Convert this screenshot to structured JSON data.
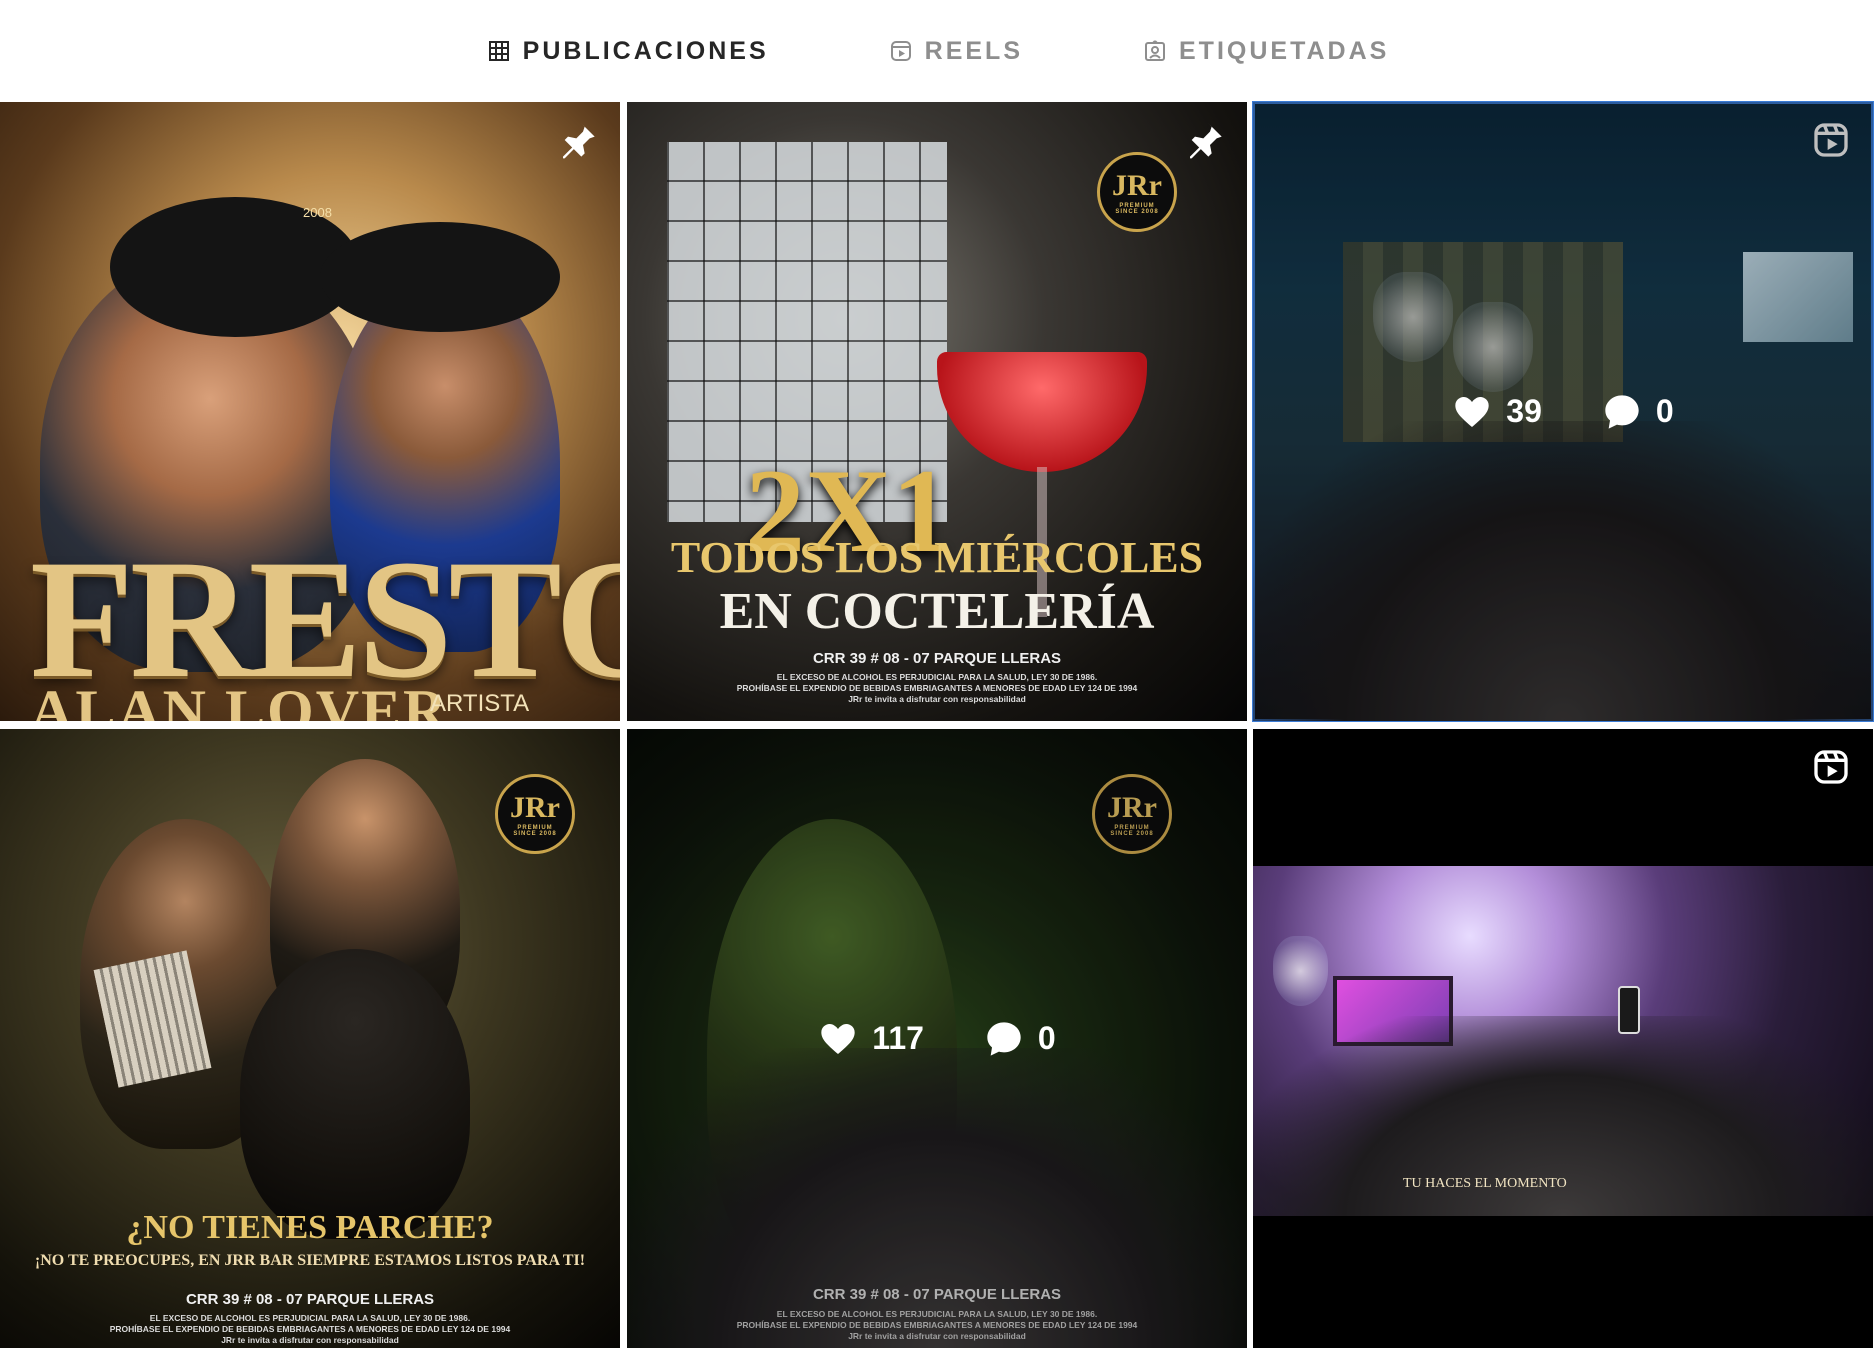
{
  "tabs": [
    {
      "label": "PUBLICACIONES",
      "icon": "grid-icon",
      "active": true
    },
    {
      "label": "REELS",
      "icon": "reels-icon",
      "active": false
    },
    {
      "label": "ETIQUETADAS",
      "icon": "tagged-icon",
      "active": false
    }
  ],
  "posts": {
    "p1": {
      "title": "FRESTO",
      "subtitle": "ALAN LOVER",
      "role": "ARTISTA",
      "year": "2008",
      "pinned": true
    },
    "p2": {
      "promo": "2X1",
      "line1": "TODOS LOS MIÉRCOLES",
      "line2": "EN COCTELERÍA",
      "address": "CRR 39 # 08 - 07  PARQUE LLERAS",
      "legal1": "EL EXCESO DE ALCOHOL ES PERJUDICIAL PARA LA SALUD, LEY 30 DE 1986.",
      "legal2": "PROHÍBASE EL EXPENDIO DE BEBIDAS EMBRIAGANTES A MENORES DE EDAD LEY 124 DE 1994",
      "legal3": "JRr te invita a disfrutar con responsabilidad",
      "badge_logo": "JRr",
      "badge_text": "PREMIUM",
      "badge_since": "SINCE 2008",
      "pinned": true
    },
    "p3": {
      "likes": "39",
      "comments": "0",
      "reel": true
    },
    "p4": {
      "headline": "¿NO TIENES PARCHE?",
      "subline": "¡NO TE PREOCUPES, EN JRR BAR SIEMPRE ESTAMOS LISTOS PARA TI!",
      "address": "CRR 39 # 08 - 07  PARQUE LLERAS",
      "legal1": "EL EXCESO DE ALCOHOL ES PERJUDICIAL PARA LA SALUD, LEY 30 DE 1986.",
      "legal2": "PROHÍBASE EL EXPENDIO DE BEBIDAS EMBRIAGANTES A MENORES DE EDAD LEY 124 DE 1994",
      "legal3": "JRr te invita a disfrutar con responsabilidad",
      "badge_logo": "JRr",
      "badge_text": "PREMIUM",
      "badge_since": "SINCE 2008"
    },
    "p5": {
      "likes": "117",
      "comments": "0",
      "address": "CRR 39 # 08 - 07  PARQUE LLERAS",
      "legal1": "EL EXCESO DE ALCOHOL ES PERJUDICIAL PARA LA SALUD, LEY 30 DE 1986.",
      "legal2": "PROHÍBASE EL EXPENDIO DE BEBIDAS EMBRIAGANTES A MENORES DE EDAD LEY 124 DE 1994",
      "legal3": "JRr te invita a disfrutar con responsabilidad",
      "badge_logo": "JRr",
      "badge_text": "PREMIUM",
      "badge_since": "SINCE 2008"
    },
    "p6": {
      "caption": "TU HACES EL MOMENTO",
      "reel": true
    }
  },
  "colors": {
    "active_tab": "#262626",
    "inactive_tab": "#8e8e8e",
    "selection_outline": "#3a7bd5",
    "gold": "#e3c584"
  }
}
